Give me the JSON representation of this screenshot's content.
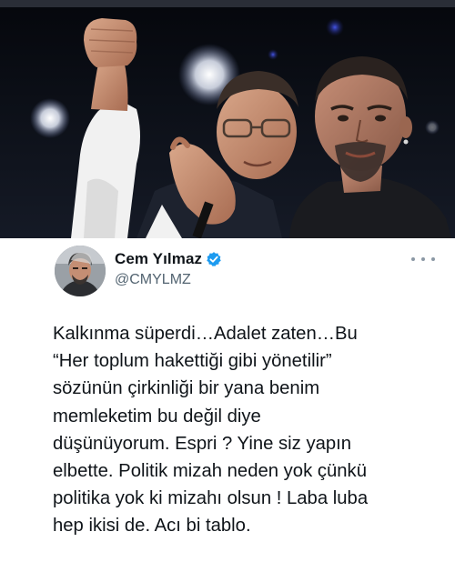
{
  "tweet": {
    "display_name": "Cem Yılmaz",
    "handle": "@CMYLMZ",
    "text": "Kalkınma süperdi…Adalet zaten…Bu\n“Her toplum hakettiği gibi yönetilir”\nsözünün çirkinliği bir yana benim\nmemleketim bu değil diye\ndüşünüyorum. Espri ? Yine siz yapın\nelbette. Politik mizah neden yok çünkü\npolitika yok ki mizahı olsun ! Laba luba\nhep ikisi de. Acı bi tablo."
  },
  "icons": {
    "verified": "verified-badge-icon",
    "more": "more-options-icon"
  },
  "colors": {
    "verified_blue": "#1d9bf0",
    "text_primary": "#0f1419",
    "text_secondary": "#536471",
    "photo_background": "#0b0d14"
  }
}
